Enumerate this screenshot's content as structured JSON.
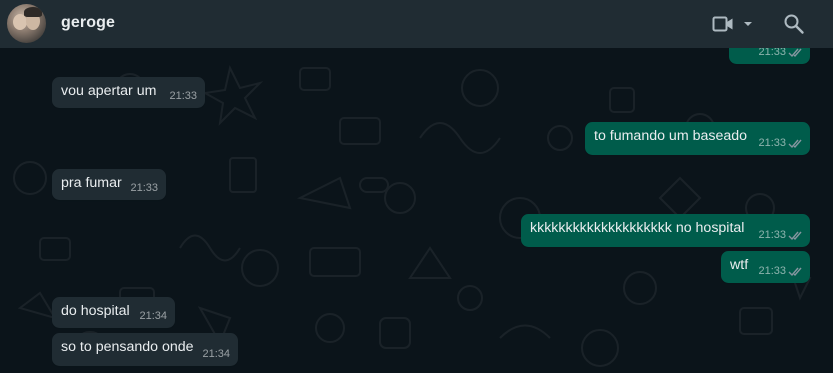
{
  "header": {
    "contact_name": "geroge",
    "icons": [
      "avatar",
      "video-call-icon",
      "chevron-down-icon",
      "search-icon"
    ]
  },
  "messages": [
    {
      "direction": "out",
      "text": "",
      "time": "21:33",
      "read": true
    },
    {
      "direction": "in",
      "text": "vou apertar um",
      "time": "21:33"
    },
    {
      "direction": "out",
      "text": "to fumando um baseado",
      "time": "21:33",
      "read": true
    },
    {
      "direction": "in",
      "text": "pra fumar",
      "time": "21:33"
    },
    {
      "direction": "out",
      "text": "kkkkkkkkkkkkkkkkkkkk no hospital",
      "time": "21:33",
      "read": true
    },
    {
      "direction": "out",
      "text": "wtf",
      "time": "21:33",
      "read": true
    },
    {
      "direction": "in",
      "text": "do hospital",
      "time": "21:34"
    },
    {
      "direction": "in",
      "text": "so to pensando onde",
      "time": "21:34"
    }
  ],
  "colors": {
    "header_bg": "#202c33",
    "chat_bg": "#0b141a",
    "incoming_bubble": "#202c33",
    "outgoing_bubble": "#005c4b",
    "text": "#e9edef",
    "read_ticks": "#8696a0"
  }
}
